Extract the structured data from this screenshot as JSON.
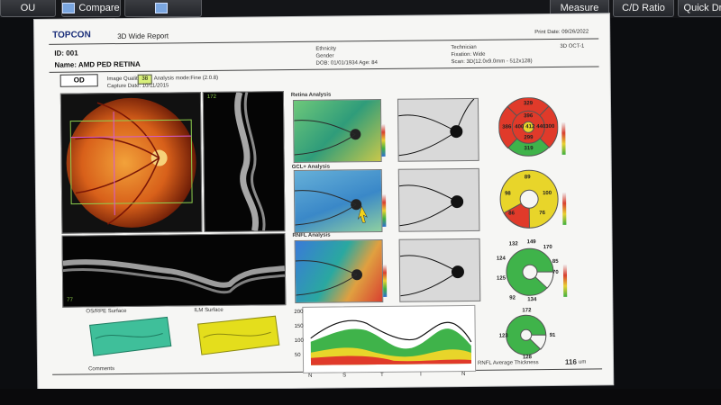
{
  "toolbar": {
    "tab_ou": "OU",
    "compare": "Compare",
    "measure": "Measure",
    "cd_ratio": "C/D Ratio",
    "quick_draw": "Quick Dra"
  },
  "report": {
    "brand": "TOPCON",
    "title": "3D Wide Report",
    "print_date": "Print Date: 09/26/2022",
    "id": "ID: 001",
    "name": "Name: AMD PED RETINA",
    "eye": "OD",
    "image_quality_label": "Image Quality",
    "image_quality_value": "38",
    "analysis_mode": "Analysis mode:Fine (2.0.8)",
    "capture_date": "Capture Date: 10/11/2015",
    "ethnicity": "Ethnicity",
    "gender": "Gender",
    "dob": "DOB: 01/01/1934   Age: 84",
    "technician": "Technician",
    "fixation": "Fixation: Wide",
    "scan": "Scan: 3D(12.0x9.0mm - 512x128)",
    "device": "3D OCT-1",
    "bscan_label_v": "172",
    "bscan_label_h": "77",
    "retina_analysis": "Retina Analysis",
    "gcl_analysis": "GCL+ Analysis",
    "rnfl_analysis": "RNFL Analysis",
    "os_rpe_surface": "OS/RPE Surface",
    "ilm_surface": "ILM Surface",
    "comments": "Comments",
    "rnfl_avg": "RNFL Average Thickness",
    "rnfl_avg_value": "116",
    "rnfl_avg_unit": "um",
    "tsnit": [
      "N",
      "S",
      "T",
      "I",
      "N"
    ],
    "tsnit_y": [
      "200",
      "150",
      "100",
      "50"
    ],
    "retina_sectors": [
      "329",
      "396",
      "386",
      "400",
      "412",
      "440",
      "300",
      "299",
      "319"
    ],
    "gcl_sectors": [
      "89",
      "98",
      "100",
      "86",
      "76"
    ],
    "rnfl_clock": [
      "132",
      "149",
      "170",
      "124",
      "162",
      "111",
      "85",
      "70",
      "134",
      "92",
      "138",
      "125"
    ],
    "rnfl_quad": [
      "172",
      "91",
      "128",
      "123"
    ]
  }
}
